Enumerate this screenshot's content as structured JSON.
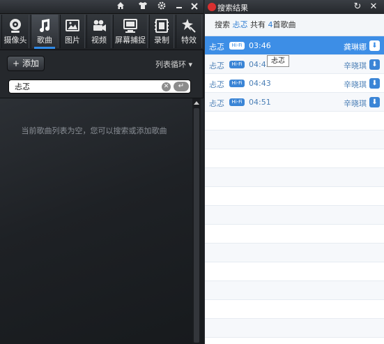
{
  "left": {
    "toolbar": [
      {
        "label": "摄像头",
        "icon": "webcam-icon"
      },
      {
        "label": "歌曲",
        "icon": "music-note-icon"
      },
      {
        "label": "图片",
        "icon": "image-icon"
      },
      {
        "label": "视频",
        "icon": "video-icon"
      },
      {
        "label": "屏幕捕捉",
        "icon": "screen-capture-icon"
      },
      {
        "label": "录制",
        "icon": "record-icon"
      },
      {
        "label": "特效",
        "icon": "effects-icon"
      }
    ],
    "add_label": "添加",
    "loop_mode": "列表循环",
    "search_value": "忐忑",
    "empty_message": "当前歌曲列表为空，您可以搜索或添加歌曲"
  },
  "right": {
    "title": "搜索结果",
    "summary": {
      "prefix": "搜索",
      "query": "忐忑",
      "middle": "共有",
      "count": "4",
      "suffix": "首歌曲"
    },
    "results": [
      {
        "name": "忐忑",
        "hifi": "Hi-Fi",
        "duration": "03:46",
        "artist": "龚琳娜"
      },
      {
        "name": "忐忑",
        "hifi": "Hi-Fi",
        "duration": "04:43",
        "artist": "辛晓琪"
      },
      {
        "name": "忐忑",
        "hifi": "Hi-Fi",
        "duration": "04:43",
        "artist": "辛晓琪"
      },
      {
        "name": "忐忑",
        "hifi": "Hi-Fi",
        "duration": "04:51",
        "artist": "辛晓琪"
      }
    ],
    "tooltip": "忐忑"
  },
  "colors": {
    "accent": "#3d8ee6",
    "dark_bg": "#25282c"
  }
}
